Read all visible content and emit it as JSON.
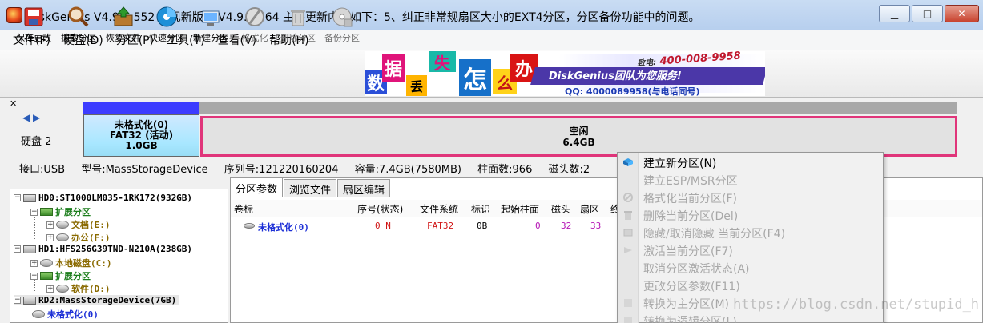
{
  "window": {
    "title": "DiskGenius V4.9.6.552   发现新版本 V4.9.6.564 主要更新内容如下：5、纠正非常规扇区大小的EXT4分区，分区备份功能中的问题。",
    "min_icon": "minimize-icon",
    "max_icon": "maximize-icon",
    "close_icon": "close-icon"
  },
  "menu": [
    "文件(F)",
    "硬盘(D)",
    "分区(P)",
    "工具(T)",
    "查看(V)",
    "帮助(H)"
  ],
  "toolbar": [
    {
      "label": "保存更改",
      "icon": "save-icon",
      "enabled": true
    },
    {
      "label": "搜索分区",
      "icon": "magnifier-icon",
      "enabled": true
    },
    {
      "label": "恢复文件",
      "icon": "recover-box-icon",
      "enabled": true
    },
    {
      "label": "快速分区",
      "icon": "quick-partition-icon",
      "enabled": true
    },
    {
      "label": "新建分区",
      "icon": "new-partition-icon",
      "enabled": true
    },
    {
      "label": "格式化",
      "icon": "format-icon",
      "enabled": false
    },
    {
      "label": "删除分区",
      "icon": "trash-icon",
      "enabled": false
    },
    {
      "label": "备份分区",
      "icon": "backup-icon",
      "enabled": false
    }
  ],
  "banner": {
    "tiles": [
      "数",
      "据",
      "丢",
      "失",
      "怎",
      "么",
      "办"
    ],
    "brand": "DiskGenius团队为您服务!",
    "phone": "400-008-9958",
    "phone_prefix": "致电:",
    "qq": "QQ: 4000089958(与电话同号)"
  },
  "diskmap": {
    "disk_label": "硬盘 2",
    "partition1": {
      "name": "未格式化(0)",
      "fs": "FAT32 (活动)",
      "size": "1.0GB"
    },
    "free": {
      "name": "空闲",
      "size": "6.4GB"
    }
  },
  "info": {
    "interface": "接口:USB",
    "model": "型号:MassStorageDevice",
    "serial": "序列号:121220160204",
    "capacity": "容量:7.4GB(7580MB)",
    "cylinders": "柱面数:966",
    "heads": "磁头数:2"
  },
  "tree": [
    {
      "label": "HD0:ST1000LM035-1RK172(932GB)",
      "kind": "disk",
      "color": "#000000"
    },
    {
      "label": "扩展分区",
      "kind": "ext",
      "color": "#1b7d1b"
    },
    {
      "label": "文档(E:)",
      "kind": "part",
      "color": "#8a6a00"
    },
    {
      "label": "办公(F:)",
      "kind": "part",
      "color": "#8a6a00"
    },
    {
      "label": "HD1:HFS256G39TND-N210A(238GB)",
      "kind": "disk",
      "color": "#000000"
    },
    {
      "label": "本地磁盘(C:)",
      "kind": "part",
      "color": "#8a6a00"
    },
    {
      "label": "扩展分区",
      "kind": "ext",
      "color": "#1b7d1b"
    },
    {
      "label": "软件(D:)",
      "kind": "part",
      "color": "#8a6a00"
    },
    {
      "label": "RD2:MassStorageDevice(7GB)",
      "kind": "disk",
      "color": "#000000"
    },
    {
      "label": "未格式化(0)",
      "kind": "part",
      "color": "#1c2fd6"
    }
  ],
  "tabs": [
    "分区参数",
    "浏览文件",
    "扇区编辑"
  ],
  "table": {
    "headers": [
      "卷标",
      "序号(状态)",
      "文件系统",
      "标识",
      "起始柱面",
      "磁头",
      "扇区",
      "终"
    ],
    "row": [
      "未格式化(0)",
      "0 N",
      "FAT32",
      "0B",
      "0",
      "32",
      "33"
    ]
  },
  "context_menu": [
    {
      "label": "建立新分区(N)",
      "enabled": true,
      "icon": "new-partition-icon"
    },
    {
      "label": "建立ESP/MSR分区",
      "enabled": false,
      "icon": ""
    },
    {
      "label": "格式化当前分区(F)",
      "enabled": false,
      "icon": "format-icon"
    },
    {
      "label": "删除当前分区(Del)",
      "enabled": false,
      "icon": "trash-icon"
    },
    {
      "label": "隐藏/取消隐藏 当前分区(F4)",
      "enabled": false,
      "icon": "hide-icon"
    },
    {
      "label": "激活当前分区(F7)",
      "enabled": false,
      "icon": "activate-icon"
    },
    {
      "label": "取消分区激活状态(A)",
      "enabled": false,
      "icon": ""
    },
    {
      "label": "更改分区参数(F11)",
      "enabled": false,
      "icon": ""
    },
    {
      "label": "转换为主分区(M)",
      "enabled": false,
      "icon": "convert-icon"
    },
    {
      "label": "转换为逻辑分区(L)",
      "enabled": false,
      "icon": "convert-icon"
    }
  ],
  "watermark": "https://blog.csdn.net/stupid_h"
}
